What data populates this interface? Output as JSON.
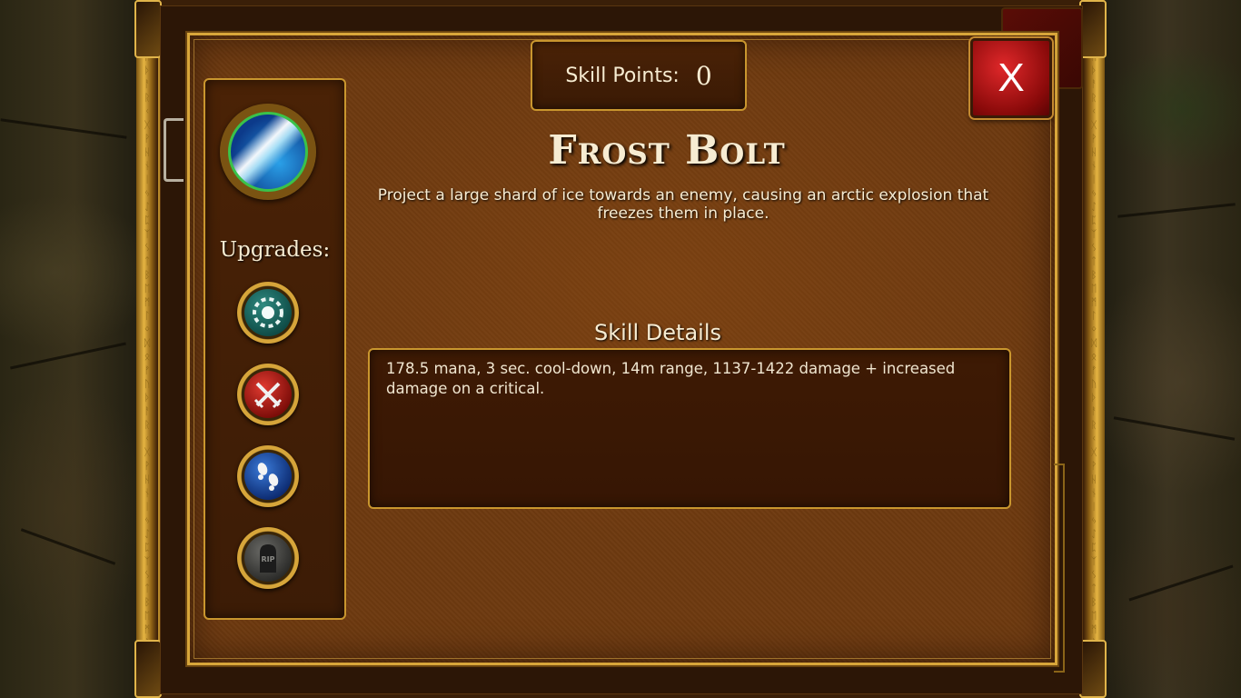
{
  "header": {
    "skill_points_label": "Skill Points:",
    "skill_points_value": "0"
  },
  "close_button": {
    "label": "X"
  },
  "skill": {
    "title": "Frost Bolt",
    "description": "Project a large shard of ice towards an enemy, causing an arctic explosion that freezes them in place.",
    "icon": "frost-bolt-icon"
  },
  "upgrades": {
    "label": "Upgrades:",
    "items": [
      {
        "icon": "chip-icon",
        "color": "#1e6b64"
      },
      {
        "icon": "crossed-swords-icon",
        "color": "#b81e18"
      },
      {
        "icon": "footprints-icon",
        "color": "#1e4ea0"
      },
      {
        "icon": "tombstone-rip-icon",
        "color": "#4a4a46"
      }
    ]
  },
  "details": {
    "heading": "Skill Details",
    "text": "178.5 mana, 3 sec. cool-down, 14m range, 1137-1422 damage + increased damage on a critical."
  },
  "colors": {
    "gold_border": "#d8a63a",
    "leather": "#6e3a10",
    "text": "#f7ecd2",
    "close_red": "#c8181a"
  }
}
